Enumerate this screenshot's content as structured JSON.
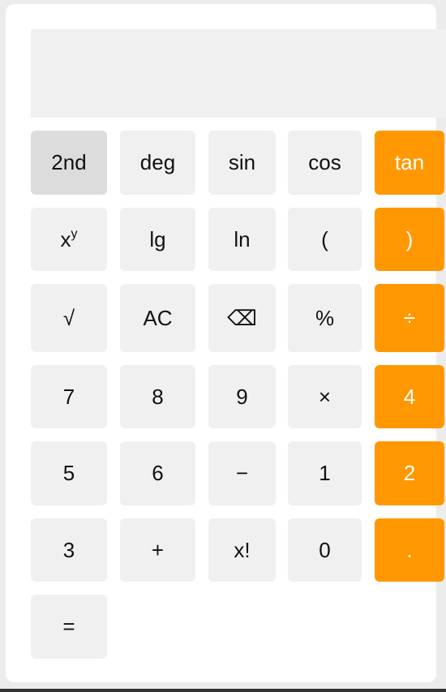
{
  "display": {
    "value": ""
  },
  "keys": {
    "second": "2nd",
    "deg": "deg",
    "sin": "sin",
    "cos": "cos",
    "tan": "tan",
    "power_base": "x",
    "power_exp": "y",
    "lg": "lg",
    "ln": "ln",
    "lparen": "(",
    "rparen": ")",
    "sqrt": "√",
    "ac": "AC",
    "backspace": "⌫",
    "percent": "%",
    "divide": "÷",
    "seven": "7",
    "eight": "8",
    "nine": "9",
    "multiply": "×",
    "four": "4",
    "five": "5",
    "six": "6",
    "minus": "−",
    "one": "1",
    "two": "2",
    "three": "3",
    "plus": "+",
    "factorial": "x!",
    "zero": "0",
    "dot": ".",
    "equals": "="
  },
  "colors": {
    "accent": "#ff9800",
    "key_bg": "#f0f0f0",
    "mode_key_bg": "#dcdcdc",
    "display_bg": "#f0f0f0"
  }
}
